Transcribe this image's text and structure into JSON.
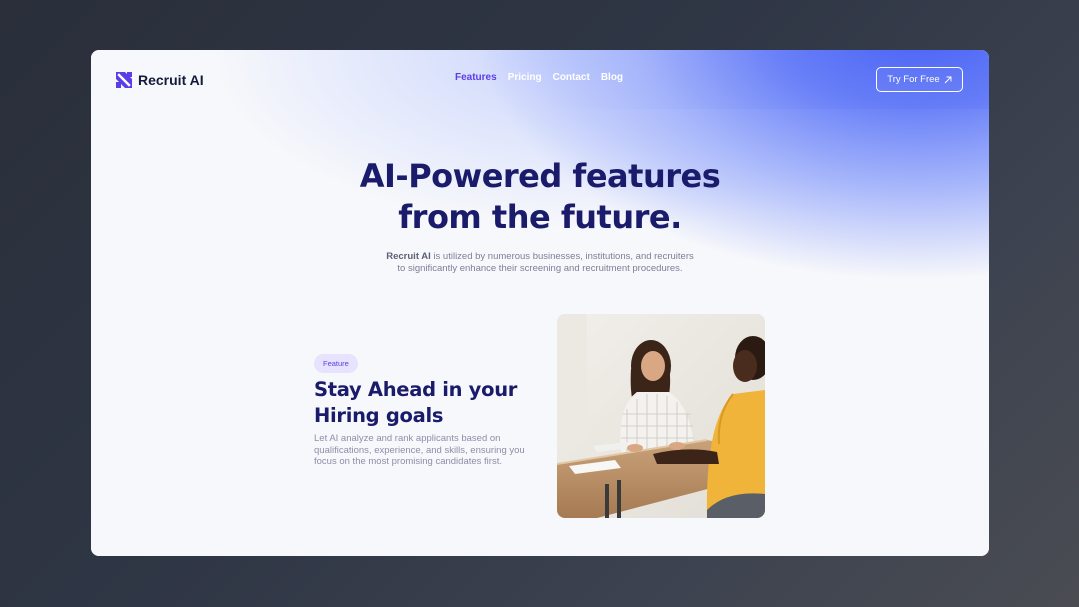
{
  "brand": {
    "name": "Recruit AI",
    "logo_icon": "recruit-logo-icon"
  },
  "nav": {
    "links": [
      {
        "label": "Features",
        "active": true
      },
      {
        "label": "Pricing",
        "active": false
      },
      {
        "label": "Contact",
        "active": false
      },
      {
        "label": "Blog",
        "active": false
      }
    ],
    "cta_label": "Try For Free",
    "cta_icon": "arrow-up-right-icon"
  },
  "hero": {
    "title_line1": "AI-Powered features",
    "title_line2": "from the future.",
    "desc_brand": "Recruit AI",
    "desc_rest": " is utilized by numerous businesses, institutions, and recruiters to significantly enhance their screening and recruitment procedures."
  },
  "feature": {
    "badge": "Feature",
    "title": "Stay Ahead in your Hiring goals",
    "description": "Let AI analyze and rank applicants based on qualifications, experience, and skills, ensuring you focus on the most promising candidates first."
  },
  "colors": {
    "accent": "#5b3ee6",
    "heading": "#1a1b6b",
    "gradient_blue": "#4a63f5",
    "backdrop": "#2f3645"
  }
}
